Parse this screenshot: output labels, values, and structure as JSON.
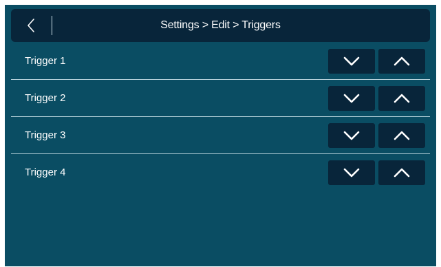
{
  "header": {
    "title": "Settings > Edit > Triggers",
    "back_icon": "chevron-left-icon"
  },
  "triggers": [
    {
      "label": "Trigger 1"
    },
    {
      "label": "Trigger 2"
    },
    {
      "label": "Trigger 3"
    },
    {
      "label": "Trigger 4"
    }
  ],
  "icons": {
    "down": "chevron-down-icon",
    "up": "chevron-up-icon"
  },
  "colors": {
    "background": "#0a4d63",
    "bar": "#08253a",
    "text": "#ffffff",
    "divider": "#b9d3dc"
  }
}
